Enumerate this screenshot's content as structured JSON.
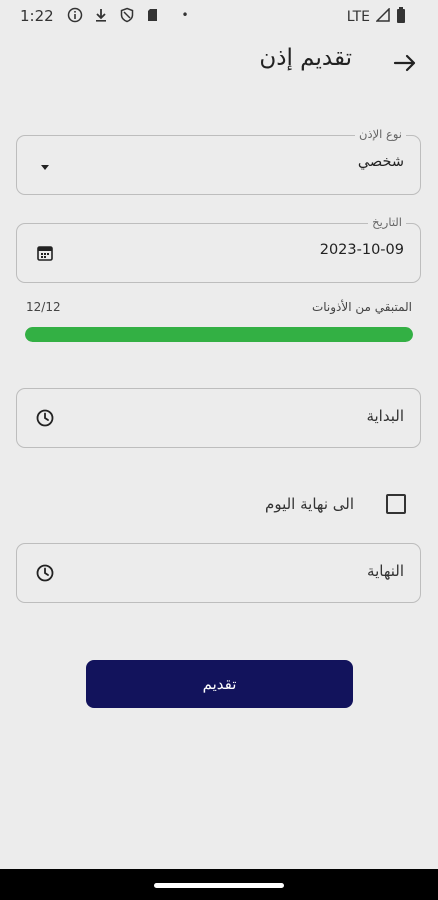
{
  "status_bar": {
    "time": "1:22",
    "left_icons": [
      "info-icon",
      "download-icon",
      "shield-icon",
      "sd-card-icon"
    ],
    "dot": "•",
    "network": "LTE",
    "right_icons": [
      "signal-icon",
      "battery-icon"
    ]
  },
  "app_bar": {
    "title": "تقديم إذن",
    "back_icon": "arrow-right-icon"
  },
  "permission_type": {
    "label": "نوع الإذن",
    "value": "شخصي",
    "icon": "dropdown-arrow-icon"
  },
  "date": {
    "label": "التاريخ",
    "value": "2023-10-09",
    "icon": "calendar-icon"
  },
  "remaining": {
    "label": "المتبقي من الأذونات",
    "count": "12/12",
    "fraction": 1.0,
    "color": "#33b044"
  },
  "start": {
    "placeholder": "البداية",
    "icon": "clock-icon"
  },
  "end_of_day": {
    "label": "الى نهاية اليوم",
    "checked": false
  },
  "end": {
    "placeholder": "النهاية",
    "icon": "clock-icon"
  },
  "submit": {
    "label": "تقديم",
    "color": "#12135c"
  }
}
